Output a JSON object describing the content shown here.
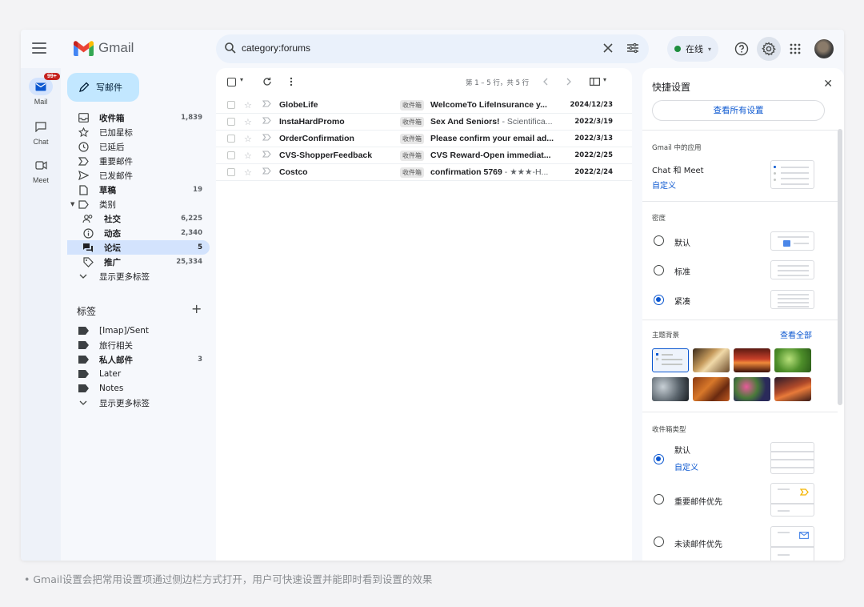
{
  "app": {
    "logo_text": "Gmail"
  },
  "search": {
    "value": "category:forums"
  },
  "status": {
    "label": "在线"
  },
  "rail": {
    "mail": "Mail",
    "mail_badge": "99+",
    "chat": "Chat",
    "meet": "Meet"
  },
  "compose": {
    "label": "写邮件"
  },
  "nav": [
    {
      "label": "收件箱",
      "count": "1,839",
      "bold": true,
      "icon": "inbox-icon"
    },
    {
      "label": "已加星标",
      "count": "",
      "icon": "star-icon"
    },
    {
      "label": "已延后",
      "count": "",
      "icon": "clock-icon"
    },
    {
      "label": "重要邮件",
      "count": "",
      "icon": "important-icon"
    },
    {
      "label": "已发邮件",
      "count": "",
      "icon": "send-icon"
    },
    {
      "label": "草稿",
      "count": "19",
      "bold": true,
      "icon": "draft-icon"
    },
    {
      "label": "类别",
      "count": "",
      "icon": "category-icon"
    },
    {
      "label": "社交",
      "count": "6,225",
      "bold": true,
      "icon": "people-icon"
    },
    {
      "label": "动态",
      "count": "2,340",
      "bold": true,
      "icon": "info-icon"
    },
    {
      "label": "论坛",
      "count": "5",
      "bold": true,
      "icon": "forum-icon"
    },
    {
      "label": "推广",
      "count": "25,334",
      "bold": true,
      "icon": "tag-icon"
    },
    {
      "label": "显示更多标签",
      "count": "",
      "icon": "chevron-down-icon"
    }
  ],
  "labels": {
    "title": "标签",
    "items": [
      {
        "label": "[Imap]/Sent",
        "count": ""
      },
      {
        "label": "旅行相关",
        "count": ""
      },
      {
        "label": "私人邮件",
        "count": "3",
        "bold": true
      },
      {
        "label": "Later",
        "count": ""
      },
      {
        "label": "Notes",
        "count": ""
      },
      {
        "label": "显示更多标签",
        "count": ""
      }
    ]
  },
  "toolbar": {
    "pagination": "第 1 – 5 行，共 5 行"
  },
  "emails": [
    {
      "sender": "GlobeLife",
      "tag": "收件箱",
      "subject": "WelcomeTo LifeInsurance y...",
      "snippet": "",
      "date": "2024/12/23"
    },
    {
      "sender": "InstaHardPromo",
      "tag": "收件箱",
      "subject": "Sex And Seniors!",
      "snippet": " - Scientifica...",
      "date": "2022/3/19"
    },
    {
      "sender": "OrderConfirmation",
      "tag": "收件箱",
      "subject": "Please confirm your email ad...",
      "snippet": "",
      "date": "2022/3/13"
    },
    {
      "sender": "CVS-ShopperFeedback",
      "tag": "收件箱",
      "subject": "CVS Reward-Open immediat...",
      "snippet": "",
      "date": "2022/2/25"
    },
    {
      "sender": "Costco",
      "tag": "收件箱",
      "subject": "confirmation 5769",
      "snippet": " - ★★★-H...",
      "date": "2022/2/24"
    }
  ],
  "quick_settings": {
    "title": "快捷设置",
    "see_all": "查看所有设置",
    "apps_heading": "Gmail 中的应用",
    "chat_meet": "Chat 和 Meet",
    "customize": "自定义",
    "density_heading": "密度",
    "density": [
      "默认",
      "标准",
      "紧凑"
    ],
    "theme_heading": "主题背景",
    "theme_view_all": "查看全部",
    "inbox_type_heading": "收件箱类型",
    "inbox_default": "默认",
    "inbox_customize": "自定义",
    "inbox_important": "重要邮件优先",
    "inbox_unread": "未读邮件优先"
  },
  "colors": {
    "accent": "#0b57d0",
    "compose_bg": "#c2e7ff",
    "selected_bg": "#d3e3fd",
    "badge": "#c5221f"
  },
  "caption": "Gmail设置会把常用设置项通过侧边栏方式打开，用户可快速设置并能即时看到设置的效果"
}
